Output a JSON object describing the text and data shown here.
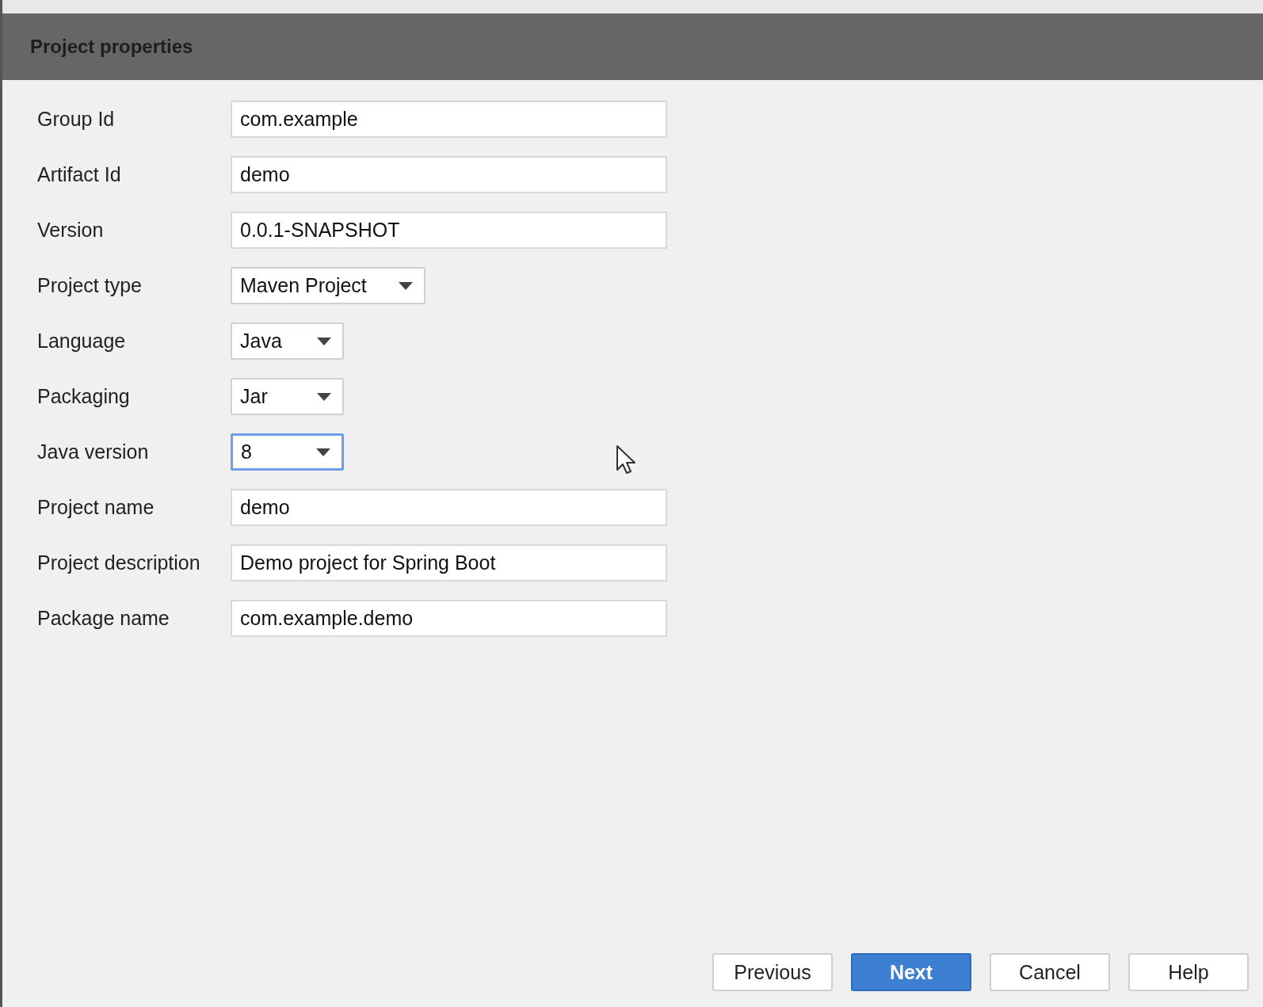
{
  "header": {
    "title": "Project properties"
  },
  "fields": [
    {
      "kind": "text",
      "label": "Group Id",
      "value": "com.example"
    },
    {
      "kind": "text",
      "label": "Artifact Id",
      "value": "demo"
    },
    {
      "kind": "text",
      "label": "Version",
      "value": "0.0.1-SNAPSHOT"
    },
    {
      "kind": "dropdown",
      "label": "Project type",
      "value": "Maven Project",
      "focused": false
    },
    {
      "kind": "dropdown",
      "label": "Language",
      "value": "Java",
      "focused": false
    },
    {
      "kind": "dropdown",
      "label": "Packaging",
      "value": "Jar",
      "focused": false
    },
    {
      "kind": "dropdown",
      "label": "Java version",
      "value": "8",
      "focused": true
    },
    {
      "kind": "text",
      "label": "Project name",
      "value": "demo"
    },
    {
      "kind": "text",
      "label": "Project description",
      "value": "Demo project for Spring Boot"
    },
    {
      "kind": "text",
      "label": "Package name",
      "value": "com.example.demo"
    }
  ],
  "buttons": [
    {
      "label": "Previous",
      "primary": false
    },
    {
      "label": "Next",
      "primary": true
    },
    {
      "label": "Cancel",
      "primary": false
    },
    {
      "label": "Help",
      "primary": false
    }
  ]
}
